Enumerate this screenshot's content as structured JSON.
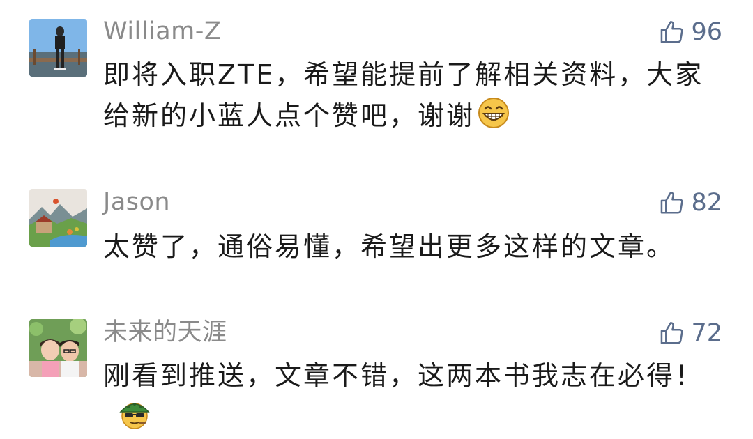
{
  "comments": [
    {
      "username": "William-Z",
      "likes": "96",
      "text": "即将入职ZTE，希望能提前了解相关资料，大家给新的小蓝人点个赞吧，谢谢",
      "emoji": "grinning-face-icon"
    },
    {
      "username": "Jason",
      "likes": "82",
      "text": "太赞了，通俗易懂，希望出更多这样的文章。"
    },
    {
      "username": "未来的天涯",
      "likes": "72",
      "text": "刚看到推送，文章不错，这两本书我志在必得！",
      "emoji": "cool-face-with-cap-icon"
    }
  ],
  "colors": {
    "username": "#8a8a8a",
    "like": "#5b6d8c",
    "text": "#1a1a1a"
  }
}
